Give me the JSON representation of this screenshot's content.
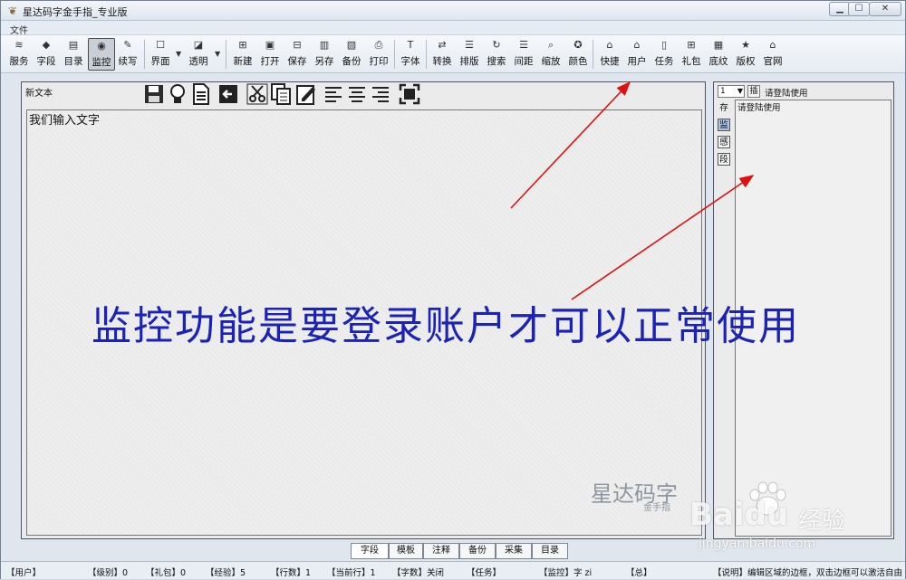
{
  "window": {
    "title": "星达码字金手指_专业版",
    "min_label": "▁",
    "max_label": "☐",
    "close_label": "✕"
  },
  "menu": {
    "file": "文件"
  },
  "toolbar": {
    "items": [
      {
        "label": "服务",
        "icon": "rss-icon"
      },
      {
        "label": "字段",
        "icon": "fields-icon"
      },
      {
        "label": "目录",
        "icon": "list-icon"
      },
      {
        "label": "监控",
        "icon": "monitor-icon",
        "active": true
      },
      {
        "label": "续写",
        "icon": "pen-icon"
      },
      {
        "label": "界面",
        "icon": "window-icon"
      },
      {
        "label": "透明",
        "icon": "transparency-icon"
      },
      {
        "label": "新建",
        "icon": "new-icon"
      },
      {
        "label": "打开",
        "icon": "open-icon"
      },
      {
        "label": "保存",
        "icon": "save-icon"
      },
      {
        "label": "另存",
        "icon": "save-as-icon"
      },
      {
        "label": "备份",
        "icon": "backup-icon"
      },
      {
        "label": "打印",
        "icon": "print-icon"
      },
      {
        "label": "字体",
        "icon": "font-icon"
      },
      {
        "label": "转换",
        "icon": "convert-icon"
      },
      {
        "label": "排版",
        "icon": "layout-icon"
      },
      {
        "label": "搜索",
        "icon": "refresh-search-icon"
      },
      {
        "label": "间距",
        "icon": "spacing-icon"
      },
      {
        "label": "缩放",
        "icon": "zoom-icon"
      },
      {
        "label": "颜色",
        "icon": "color-icon"
      },
      {
        "label": "快捷",
        "icon": "shortcut-icon"
      },
      {
        "label": "用户",
        "icon": "user-icon"
      },
      {
        "label": "任务",
        "icon": "task-icon"
      },
      {
        "label": "礼包",
        "icon": "gift-icon"
      },
      {
        "label": "底纹",
        "icon": "texture-icon"
      },
      {
        "label": "版权",
        "icon": "star-icon"
      },
      {
        "label": "官网",
        "icon": "home-icon"
      }
    ]
  },
  "editor": {
    "doc_title": "新文本",
    "content": "我们输入文字",
    "overlay": "监控功能是要登录账户才可以正常使用",
    "watermark": "星达码字",
    "watermark_sub": "金手指"
  },
  "side": {
    "select_value": "1",
    "insert_label": "插",
    "login_hint": "请登陆使用",
    "tabs": [
      "存",
      "监",
      "感",
      "段"
    ],
    "body_text": "请登陆使用"
  },
  "bottom_tabs": [
    "字段",
    "模板",
    "注释",
    "备份",
    "采集",
    "目录"
  ],
  "status": {
    "user": "【用户】",
    "level": "【级别】0",
    "gift": "【礼包】0",
    "exp": "【经验】5",
    "lines": "【行数】1",
    "current_line": "【当前行】1",
    "chars": "【字数】关闭",
    "task": "【任务】",
    "monitor": "【监控】字 zi",
    "total": "【总】",
    "help": "【说明】编辑区域的边框，双击边框可以激活自由"
  },
  "baidu": {
    "logo": "Baidu",
    "cn": "经验",
    "url": "jingyan.baidu.com"
  },
  "colors": {
    "overlay": "#1b22b8",
    "arrow": "#e01010"
  }
}
